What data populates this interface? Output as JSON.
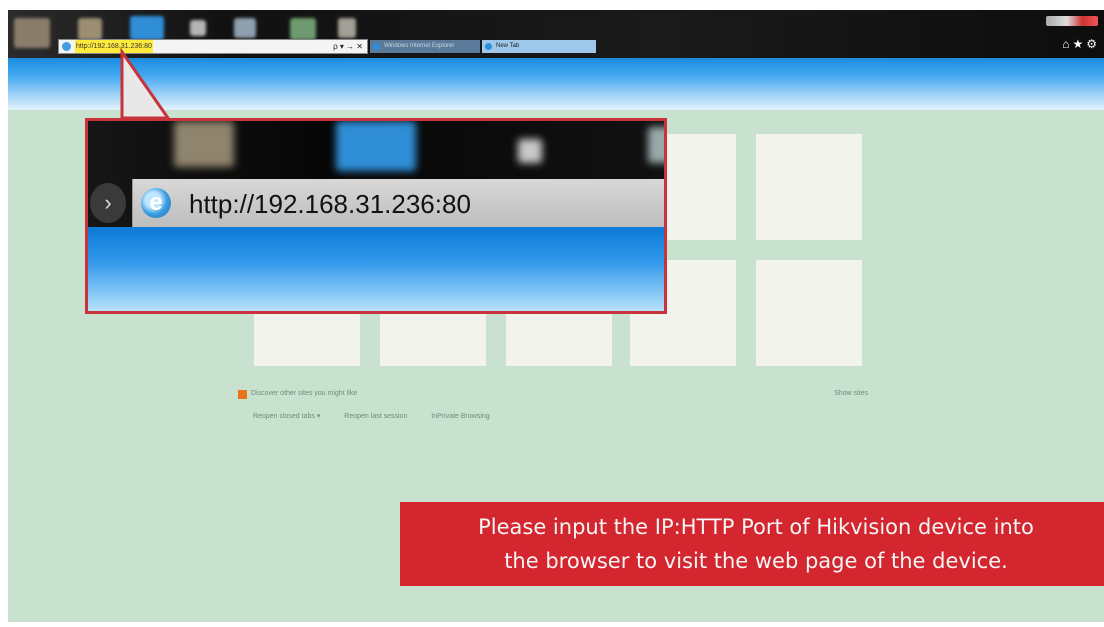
{
  "browser": {
    "address_url": "http://192.168.31.236:80",
    "address_controls": "ρ ▾ → ✕",
    "tabs": [
      {
        "label": "Windows Internet Explorer"
      },
      {
        "label": "New Tab"
      }
    ],
    "toolbar_icons": [
      "home-icon",
      "favorites-star-icon",
      "settings-gear-icon"
    ]
  },
  "new_tab_page": {
    "discover_text": "Discover other sites you might like",
    "show_sites": "Show sites",
    "links": [
      "Reopen closed tabs ▾",
      "Reopen last session",
      "InPrivate Browsing"
    ]
  },
  "zoom_callout": {
    "url": "http://192.168.31.236:80"
  },
  "banner": {
    "line1": "Please input the IP:HTTP Port of Hikvision device into",
    "line2": "the browser to visit the web page of the device."
  },
  "colors": {
    "page_bg": "#c8e2cf",
    "callout_border": "#c8323a",
    "banner_bg": "#d3262e",
    "toolbar_blue": "#1a8be0"
  }
}
